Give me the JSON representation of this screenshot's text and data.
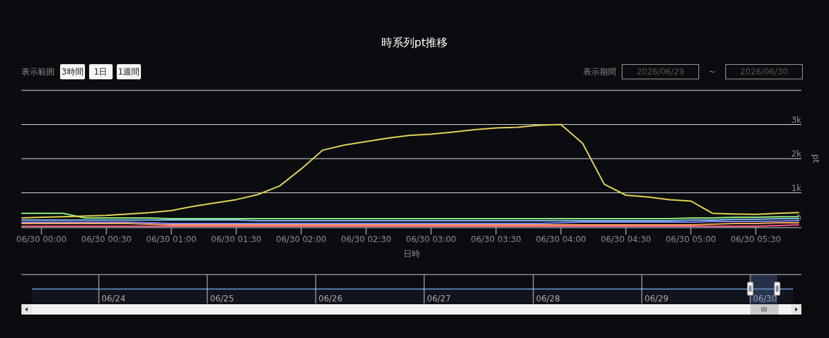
{
  "title": "時系列pt推移",
  "range_selector": {
    "label": "表示範囲",
    "buttons": [
      {
        "label": "3時間",
        "selected": false
      },
      {
        "label": "1日",
        "selected": false
      },
      {
        "label": "1週間",
        "selected": false
      }
    ]
  },
  "date_range": {
    "label": "表示期間",
    "from": "2026/06/29",
    "separator": "～",
    "to": "2026/06/30"
  },
  "chart": {
    "chart_data": {
      "type": "line",
      "xlabel": "日時",
      "ylabel": "pt",
      "categories": [
        null,
        "06/30 00:00",
        null,
        null,
        "06/30 00:30",
        null,
        null,
        "06/30 01:00",
        null,
        null,
        "06/30 01:30",
        null,
        null,
        "06/30 02:00",
        null,
        null,
        "06/30 02:30",
        null,
        null,
        "06/30 03:00",
        null,
        null,
        "06/30 03:30",
        null,
        null,
        "06/30 04:00",
        null,
        null,
        "06/30 04:30",
        null,
        null,
        "06/30 05:00",
        null,
        null,
        "06/30 05:30",
        null,
        null
      ],
      "ylim": [
        0,
        4000
      ],
      "grid": true,
      "yticks": [
        {
          "value": 0,
          "label": "0"
        },
        {
          "value": 1000,
          "label": "1k"
        },
        {
          "value": 2000,
          "label": "2k"
        },
        {
          "value": 3000,
          "label": "3k"
        }
      ],
      "series": [
        {
          "color": "#f15c80",
          "values": [
            20,
            20,
            20,
            20,
            20,
            20,
            20,
            20,
            20,
            20,
            20,
            20,
            20,
            20,
            20,
            20,
            20,
            20,
            20,
            20,
            20,
            20,
            20,
            20,
            20,
            20,
            20,
            20,
            20,
            20,
            20,
            20,
            20,
            20,
            20,
            40,
            60
          ]
        },
        {
          "color": "#f7a35c",
          "values": [
            100,
            100,
            100,
            100,
            100,
            100,
            80,
            60,
            60,
            60,
            60,
            60,
            60,
            60,
            60,
            60,
            60,
            60,
            60,
            60,
            60,
            60,
            60,
            60,
            60,
            60,
            60,
            60,
            60,
            60,
            60,
            60,
            80,
            100,
            100,
            120,
            120
          ]
        },
        {
          "color": "#8085e9",
          "values": [
            140,
            140,
            140,
            140,
            140,
            140,
            120,
            100,
            100,
            100,
            100,
            100,
            100,
            100,
            100,
            100,
            100,
            100,
            100,
            100,
            100,
            100,
            100,
            100,
            100,
            120,
            140,
            140,
            140,
            140,
            140,
            140,
            160,
            160,
            160,
            170,
            180
          ]
        },
        {
          "color": "#7cb5ec",
          "values": [
            200,
            200,
            200,
            200,
            200,
            200,
            200,
            200,
            200,
            200,
            200,
            180,
            180,
            180,
            180,
            180,
            180,
            180,
            180,
            180,
            180,
            180,
            180,
            180,
            180,
            180,
            180,
            180,
            180,
            180,
            180,
            200,
            200,
            220,
            220,
            240,
            240
          ]
        },
        {
          "color": "#90ed7d",
          "values": [
            400,
            400,
            400,
            260,
            260,
            260,
            260,
            240,
            240,
            240,
            240,
            240,
            240,
            240,
            240,
            240,
            240,
            240,
            240,
            240,
            240,
            240,
            240,
            240,
            240,
            240,
            240,
            240,
            240,
            240,
            240,
            260,
            260,
            280,
            280,
            300,
            300
          ]
        },
        {
          "color": "#e4d354",
          "values": [
            260,
            280,
            300,
            320,
            340,
            380,
            420,
            480,
            600,
            700,
            800,
            950,
            1200,
            1700,
            2250,
            2400,
            2500,
            2600,
            2680,
            2720,
            2780,
            2850,
            2900,
            2920,
            2980,
            3000,
            2450,
            1250,
            930,
            880,
            800,
            760,
            400,
            380,
            370,
            400,
            420
          ]
        }
      ]
    }
  },
  "navigator": {
    "labels": [
      "06/24",
      "06/25",
      "06/26",
      "06/27",
      "06/28",
      "06/29",
      "06/30"
    ]
  }
}
